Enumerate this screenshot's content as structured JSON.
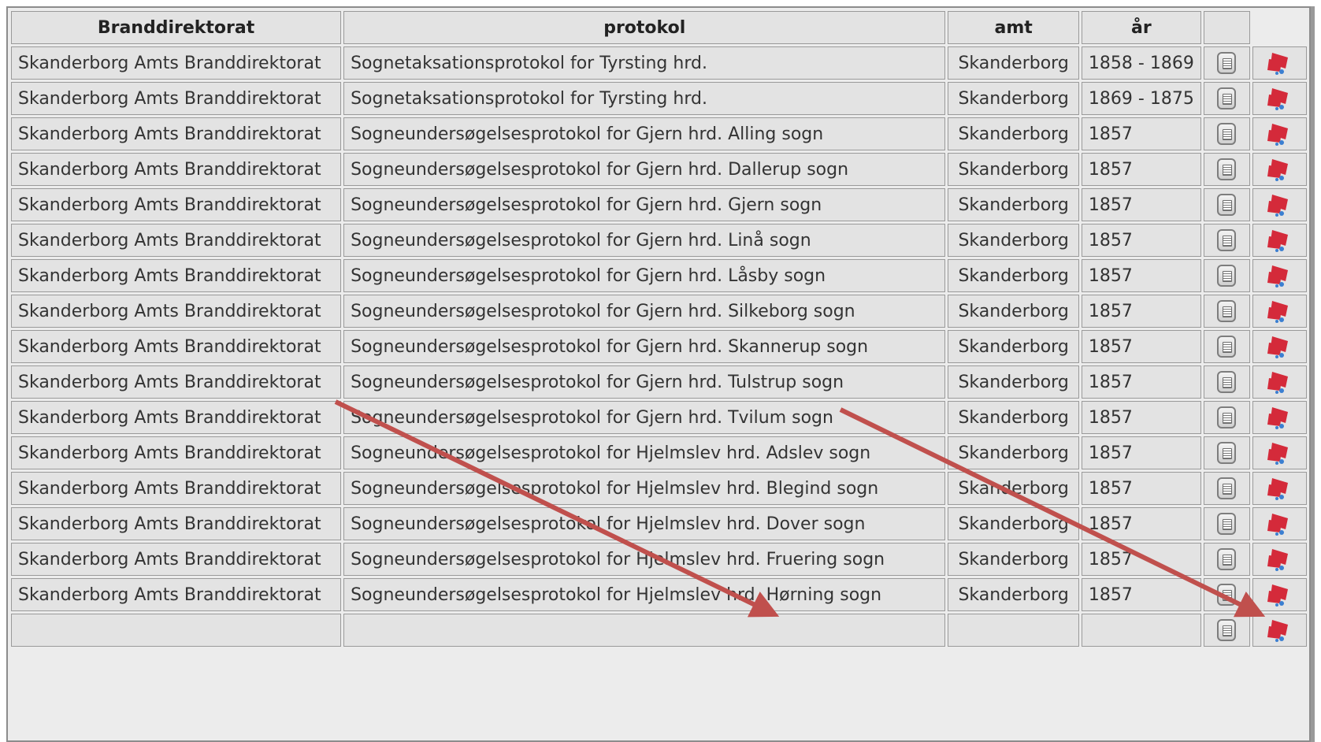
{
  "table": {
    "headers": {
      "directorate": "Branddirektorat",
      "protocol": "protokol",
      "county": "amt",
      "year": "år"
    },
    "rows": [
      {
        "directorate": "Skanderborg Amts Branddirektorat",
        "protocol": "Sognetaksationsprotokol for Tyrsting hrd.",
        "county": "Skanderborg",
        "year": "1858 - 1869"
      },
      {
        "directorate": "Skanderborg Amts Branddirektorat",
        "protocol": "Sognetaksationsprotokol for Tyrsting hrd.",
        "county": "Skanderborg",
        "year": "1869 - 1875"
      },
      {
        "directorate": "Skanderborg Amts Branddirektorat",
        "protocol": "Sogneundersøgelsesprotokol for Gjern hrd. Alling sogn",
        "county": "Skanderborg",
        "year": "1857"
      },
      {
        "directorate": "Skanderborg Amts Branddirektorat",
        "protocol": "Sogneundersøgelsesprotokol for Gjern hrd. Dallerup sogn",
        "county": "Skanderborg",
        "year": "1857"
      },
      {
        "directorate": "Skanderborg Amts Branddirektorat",
        "protocol": "Sogneundersøgelsesprotokol for Gjern hrd. Gjern sogn",
        "county": "Skanderborg",
        "year": "1857"
      },
      {
        "directorate": "Skanderborg Amts Branddirektorat",
        "protocol": "Sogneundersøgelsesprotokol for Gjern hrd. Linå sogn",
        "county": "Skanderborg",
        "year": "1857"
      },
      {
        "directorate": "Skanderborg Amts Branddirektorat",
        "protocol": "Sogneundersøgelsesprotokol for Gjern hrd. Låsby sogn",
        "county": "Skanderborg",
        "year": "1857"
      },
      {
        "directorate": "Skanderborg Amts Branddirektorat",
        "protocol": "Sogneundersøgelsesprotokol for Gjern hrd. Silkeborg sogn",
        "county": "Skanderborg",
        "year": "1857"
      },
      {
        "directorate": "Skanderborg Amts Branddirektorat",
        "protocol": "Sogneundersøgelsesprotokol for Gjern hrd. Skannerup sogn",
        "county": "Skanderborg",
        "year": "1857"
      },
      {
        "directorate": "Skanderborg Amts Branddirektorat",
        "protocol": "Sogneundersøgelsesprotokol for Gjern hrd. Tulstrup sogn",
        "county": "Skanderborg",
        "year": "1857"
      },
      {
        "directorate": "Skanderborg Amts Branddirektorat",
        "protocol": "Sogneundersøgelsesprotokol for Gjern hrd. Tvilum sogn",
        "county": "Skanderborg",
        "year": "1857"
      },
      {
        "directorate": "Skanderborg Amts Branddirektorat",
        "protocol": "Sogneundersøgelsesprotokol for Hjelmslev hrd. Adslev sogn",
        "county": "Skanderborg",
        "year": "1857"
      },
      {
        "directorate": "Skanderborg Amts Branddirektorat",
        "protocol": "Sogneundersøgelsesprotokol for Hjelmslev hrd. Blegind sogn",
        "county": "Skanderborg",
        "year": "1857"
      },
      {
        "directorate": "Skanderborg Amts Branddirektorat",
        "protocol": "Sogneundersøgelsesprotokol for Hjelmslev hrd. Dover sogn",
        "county": "Skanderborg",
        "year": "1857"
      },
      {
        "directorate": "Skanderborg Amts Branddirektorat",
        "protocol": "Sogneundersøgelsesprotokol for Hjelmslev hrd. Fruering sogn",
        "county": "Skanderborg",
        "year": "1857"
      },
      {
        "directorate": "Skanderborg Amts Branddirektorat",
        "protocol": "Sogneundersøgelsesprotokol for Hjelmslev hrd. Hørning sogn",
        "county": "Skanderborg",
        "year": "1857"
      },
      {
        "directorate": "",
        "protocol": "",
        "county": "",
        "year": ""
      }
    ]
  },
  "icons": {
    "details": "document-icon",
    "map": "flag-map-icon"
  },
  "colors": {
    "arrow": "#c0504d",
    "flag_red": "#d42a3a",
    "flag_blue": "#3b7fd1"
  }
}
